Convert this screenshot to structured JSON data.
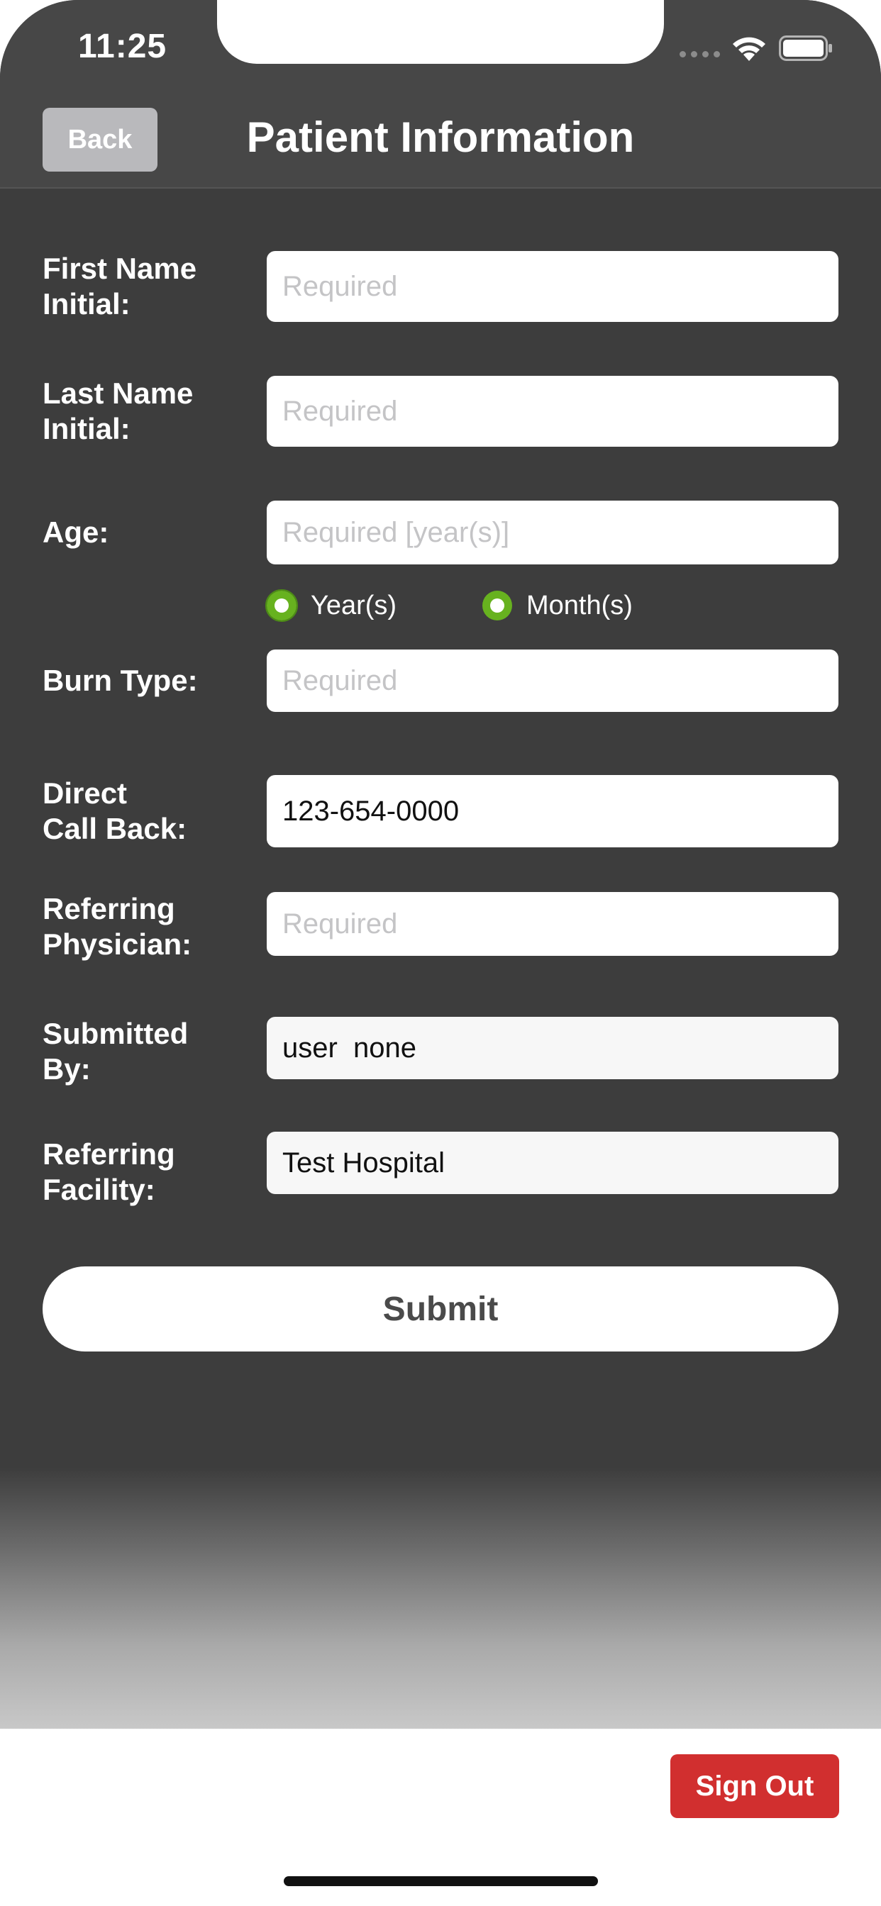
{
  "status_bar": {
    "time": "11:25"
  },
  "nav": {
    "back_label": "Back",
    "title": "Patient Information"
  },
  "form": {
    "first_name": {
      "label_line1": "First Name",
      "label_line2": "Initial:",
      "value": "",
      "placeholder": "Required"
    },
    "last_name": {
      "label_line1": "Last Name",
      "label_line2": "Initial:",
      "value": "",
      "placeholder": "Required"
    },
    "age": {
      "label": "Age:",
      "value": "",
      "placeholder": "Required [year(s)]",
      "unit_options": [
        "Year(s)",
        "Month(s)"
      ],
      "selected_unit": "Year(s)"
    },
    "burn_type": {
      "label": "Burn Type:",
      "value": "",
      "placeholder": "Required"
    },
    "direct_call_back": {
      "label_line1": "Direct",
      "label_line2": "Call Back:",
      "value": "123-654-0000",
      "placeholder": ""
    },
    "referring_physician": {
      "label_line1": "Referring",
      "label_line2": "Physician:",
      "value": "",
      "placeholder": "Required"
    },
    "submitted_by": {
      "label_line1": "Submitted",
      "label_line2": "By:",
      "value": "user  none",
      "placeholder": ""
    },
    "referring_facility": {
      "label_line1": "Referring",
      "label_line2": "Facility:",
      "value": "Test Hospital",
      "placeholder": ""
    },
    "submit_label": "Submit"
  },
  "footer": {
    "sign_out_label": "Sign Out"
  },
  "colors": {
    "background": "#3d3d3d",
    "nav_bar": "#474747",
    "radio_accent": "#67b21f",
    "sign_out": "#d12f2f",
    "back_button": "#b9b9bc"
  },
  "icons": {
    "signal": "cellular-signal-icon",
    "wifi": "wifi-icon",
    "battery": "battery-icon"
  }
}
